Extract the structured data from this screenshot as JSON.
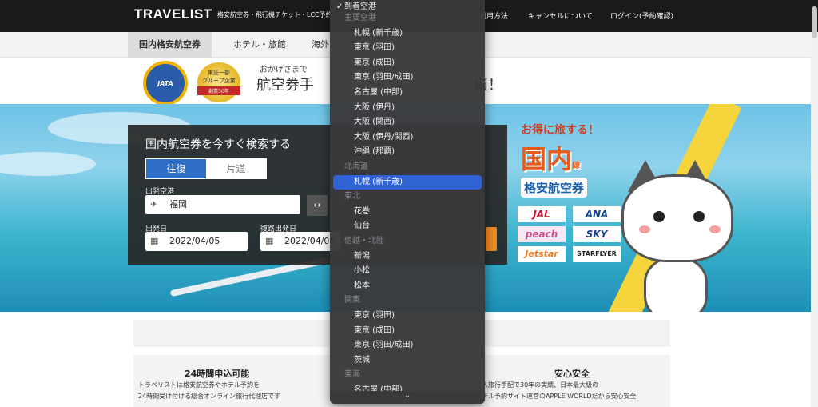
{
  "header": {
    "logo": "TRAVELIST",
    "nav_left": "格安航空券・飛行機チケット・LCC予約",
    "nav": [
      {
        "label": "利用方法"
      },
      {
        "label": "キャンセルについて"
      },
      {
        "label": "ログイン(予約確認)"
      }
    ]
  },
  "subnav": {
    "tabs": [
      {
        "label": "国内格安航空券",
        "active": true
      },
      {
        "label": "ホテル・旅館",
        "active": false
      },
      {
        "label": "海外",
        "active": false
      }
    ]
  },
  "banner": {
    "jata": "JATA",
    "badge_line1": "東証一部",
    "badge_line2": "グループ企業",
    "badge_ribbon": "創業30年",
    "small_text": "おかげさまで",
    "big_text": "航空券手",
    "big_text_right": "績！"
  },
  "hero": {
    "promo_small": "お得に旅する！",
    "promo_big": "国内",
    "promo_big_suffix": "線",
    "promo_sub": "格安航空券",
    "airlines": {
      "jal": "JAL",
      "ana": "ANA",
      "peach": "peach",
      "sky": "SKY",
      "jetstar": "Jetstar",
      "starflyer": "STARFLYER"
    }
  },
  "search": {
    "title": "国内航空券を今すぐ検索する",
    "roundtrip_label": "往復",
    "oneway_label": "片道",
    "departure_label": "出発空港",
    "departure_value": "福岡",
    "swap_label": "↔",
    "depart_date_label": "出発日",
    "depart_date_value": "2022/04/05",
    "return_date_label": "復路出発日",
    "return_date_value": "2022/04/06"
  },
  "features": [
    {
      "title": "24時間申込可能",
      "line1": "トラベリストは格安航空券やホテル予約を",
      "line2": "24時間受け付ける総合オンライン旅行代理店です"
    },
    {
      "title": "安心安全",
      "line1": "個人旅行手配で30年の実績、日本最大級の",
      "line2": "ホテル予約サイト運営のAPPLE WORLDだから安心安全"
    }
  ],
  "dropdown": {
    "current": "到着空港",
    "checkmark": "✓",
    "scroll_arrow": "⌄",
    "items": [
      {
        "type": "group",
        "label": "主要空港"
      },
      {
        "type": "option",
        "label": "札幌 (新千歳)"
      },
      {
        "type": "option",
        "label": "東京 (羽田)"
      },
      {
        "type": "option",
        "label": "東京 (成田)"
      },
      {
        "type": "option",
        "label": "東京 (羽田/成田)"
      },
      {
        "type": "option",
        "label": "名古屋 (中部)"
      },
      {
        "type": "option",
        "label": "大阪 (伊丹)"
      },
      {
        "type": "option",
        "label": "大阪 (関西)"
      },
      {
        "type": "option",
        "label": "大阪 (伊丹/関西)"
      },
      {
        "type": "option",
        "label": "沖縄 (那覇)"
      },
      {
        "type": "group",
        "label": "北海道"
      },
      {
        "type": "option",
        "label": "札幌 (新千歳)",
        "highlighted": true
      },
      {
        "type": "group",
        "label": "東北"
      },
      {
        "type": "option",
        "label": "花巻"
      },
      {
        "type": "option",
        "label": "仙台"
      },
      {
        "type": "group",
        "label": "信越・北陸"
      },
      {
        "type": "option",
        "label": "新潟"
      },
      {
        "type": "option",
        "label": "小松"
      },
      {
        "type": "option",
        "label": "松本"
      },
      {
        "type": "group",
        "label": "関東"
      },
      {
        "type": "option",
        "label": "東京 (羽田)"
      },
      {
        "type": "option",
        "label": "東京 (成田)"
      },
      {
        "type": "option",
        "label": "東京 (羽田/成田)"
      },
      {
        "type": "option",
        "label": "茨城"
      },
      {
        "type": "group",
        "label": "東海"
      },
      {
        "type": "option",
        "label": "名古屋 (中部)"
      }
    ]
  },
  "colors": {
    "highlight": "#2f63d3",
    "topbar": "#1a1a1a",
    "roundtrip_active": "#2f6ec7",
    "search_button": "#f08a24"
  }
}
